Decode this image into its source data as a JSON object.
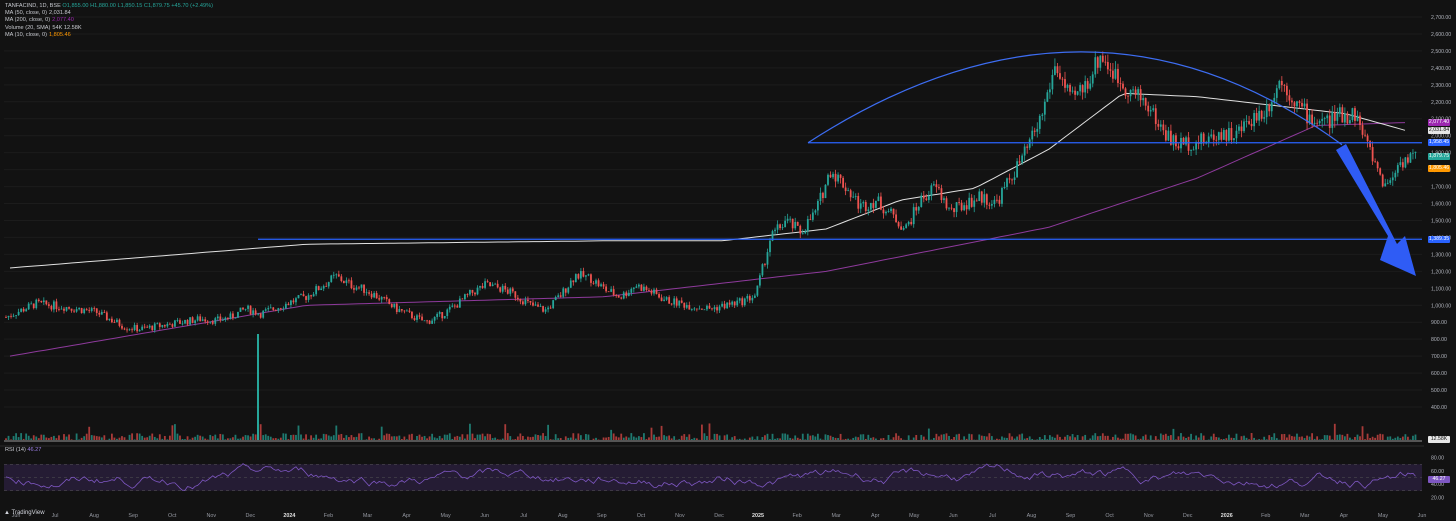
{
  "header": {
    "symbol_line": "TANFACIND, 1D, BSE",
    "ohlc": "O1,855.00 H1,880.00 L1,850.15 C1,879.75 +45.70 (+2.49%)",
    "indicators": [
      {
        "label": "MA (50, close, 0)",
        "value": "2,031.84",
        "color": "#e6e6e6"
      },
      {
        "label": "MA (200, close, 0)",
        "value": "2,077.40",
        "color": "#9c27b0"
      },
      {
        "label": "Volume (20, SMA)",
        "value": "54K  12.58K",
        "color": "#26a69a"
      },
      {
        "label": "MA (10, close, 0)",
        "value": "1,805.46",
        "color": "#ff9800"
      }
    ]
  },
  "rsi_legend": {
    "label": "RSI (14)",
    "value": "46.27"
  },
  "price_axis": {
    "ticks": [
      "2,700.00",
      "2,600.00",
      "2,500.00",
      "2,400.00",
      "2,300.00",
      "2,200.00",
      "2,100.00",
      "2,000.00",
      "1,900.00",
      "1,800.00",
      "1,700.00",
      "1,600.00",
      "1,500.00",
      "1,400.00",
      "1,300.00",
      "1,200.00",
      "1,100.00",
      "1,000.00",
      "900.00",
      "800.00",
      "700.00",
      "600.00",
      "500.00",
      "400.00"
    ],
    "tags": [
      {
        "text": "2,077.40",
        "color": "#9c27b0",
        "price": 2077.4
      },
      {
        "text": "2,031.84",
        "color": "#e6e6e6",
        "price": 2031.84,
        "dark": true
      },
      {
        "text": "1,958.45",
        "color": "#2962ff",
        "price": 1958.45
      },
      {
        "text": "1,879.75",
        "color": "#26a69a",
        "price": 1879.75
      },
      {
        "text": "1,805.46",
        "color": "#ff9800",
        "price": 1805.46
      },
      {
        "text": "1,389.35",
        "color": "#2962ff",
        "price": 1389.35
      }
    ],
    "volume_tag": "12.58K"
  },
  "rsi_axis": {
    "ticks": [
      "80.00",
      "60.00",
      "40.00",
      "20.00"
    ],
    "value_tag": "46.27"
  },
  "time_axis": [
    "Jun",
    "Jul",
    "Aug",
    "Sep",
    "Oct",
    "Nov",
    "Dec",
    "2024",
    "Feb",
    "Mar",
    "Apr",
    "May",
    "Jun",
    "Jul",
    "Aug",
    "Sep",
    "Oct",
    "Nov",
    "Dec",
    "2025",
    "Feb",
    "Mar",
    "Apr",
    "May",
    "Jun",
    "Jul",
    "Aug",
    "Sep",
    "Oct",
    "Nov",
    "Dec",
    "2026",
    "Feb",
    "Mar",
    "Apr",
    "May",
    "Jun"
  ],
  "footer": {
    "brand": "TradingView"
  },
  "chart_data": {
    "type": "candlestick",
    "symbol": "TANFACIND",
    "interval": "1D",
    "ylim": [
      350,
      2750
    ],
    "lines": {
      "resistance": 1958.45,
      "support": 1389.35
    },
    "price_path": [
      [
        0,
        930
      ],
      [
        2,
        1010
      ],
      [
        4,
        990
      ],
      [
        6,
        960
      ],
      [
        8,
        870
      ],
      [
        9,
        860
      ],
      [
        11,
        890
      ],
      [
        13,
        920
      ],
      [
        14,
        910
      ],
      [
        15,
        930
      ],
      [
        16,
        980
      ],
      [
        17,
        950
      ],
      [
        19,
        1020
      ],
      [
        20,
        1050
      ],
      [
        22,
        1170
      ],
      [
        23,
        1120
      ],
      [
        24,
        1090
      ],
      [
        25,
        1040
      ],
      [
        26,
        980
      ],
      [
        27,
        940
      ],
      [
        28,
        900
      ],
      [
        29,
        940
      ],
      [
        30,
        1000
      ],
      [
        31,
        1070
      ],
      [
        32,
        1120
      ],
      [
        33,
        1100
      ],
      [
        34,
        1060
      ],
      [
        35,
        1000
      ],
      [
        36,
        970
      ],
      [
        37,
        1060
      ],
      [
        38,
        1180
      ],
      [
        39,
        1160
      ],
      [
        40,
        1090
      ],
      [
        41,
        1050
      ],
      [
        42,
        1120
      ],
      [
        43,
        1080
      ],
      [
        44,
        1030
      ],
      [
        45,
        1010
      ],
      [
        46,
        990
      ],
      [
        47,
        980
      ],
      [
        48,
        1000
      ],
      [
        49,
        1020
      ],
      [
        50,
        1060
      ],
      [
        51,
        1400
      ],
      [
        52,
        1500
      ],
      [
        53,
        1430
      ],
      [
        54,
        1550
      ],
      [
        55,
        1800
      ],
      [
        56,
        1700
      ],
      [
        57,
        1580
      ],
      [
        58,
        1620
      ],
      [
        59,
        1540
      ],
      [
        60,
        1450
      ],
      [
        61,
        1620
      ],
      [
        62,
        1700
      ],
      [
        63,
        1550
      ],
      [
        64,
        1600
      ],
      [
        65,
        1640
      ],
      [
        66,
        1600
      ],
      [
        67,
        1750
      ],
      [
        68,
        1900
      ],
      [
        69,
        2100
      ],
      [
        70,
        2420
      ],
      [
        71,
        2200
      ],
      [
        72,
        2300
      ],
      [
        73,
        2480
      ],
      [
        74,
        2350
      ],
      [
        75,
        2260
      ],
      [
        76,
        2200
      ],
      [
        77,
        2050
      ],
      [
        78,
        1950
      ],
      [
        79,
        1960
      ],
      [
        80,
        1970
      ],
      [
        81,
        2020
      ],
      [
        82,
        2000
      ],
      [
        83,
        2100
      ],
      [
        84,
        2150
      ],
      [
        85,
        2330
      ],
      [
        86,
        2200
      ],
      [
        87,
        2100
      ],
      [
        88,
        2080
      ],
      [
        89,
        2120
      ],
      [
        90,
        2130
      ],
      [
        91,
        1900
      ],
      [
        92,
        1700
      ],
      [
        93,
        1850
      ],
      [
        94,
        1880
      ]
    ],
    "ma50": [
      [
        0,
        1220
      ],
      [
        10,
        1290
      ],
      [
        20,
        1360
      ],
      [
        30,
        1370
      ],
      [
        40,
        1380
      ],
      [
        48,
        1380
      ],
      [
        55,
        1450
      ],
      [
        60,
        1620
      ],
      [
        65,
        1690
      ],
      [
        70,
        1920
      ],
      [
        75,
        2250
      ],
      [
        80,
        2230
      ],
      [
        85,
        2180
      ],
      [
        90,
        2130
      ],
      [
        94,
        2031.84
      ]
    ],
    "ma200": [
      [
        0,
        700
      ],
      [
        20,
        1000
      ],
      [
        40,
        1050
      ],
      [
        55,
        1200
      ],
      [
        70,
        1460
      ],
      [
        80,
        1750
      ],
      [
        88,
        2060
      ],
      [
        94,
        2077.4
      ]
    ]
  }
}
